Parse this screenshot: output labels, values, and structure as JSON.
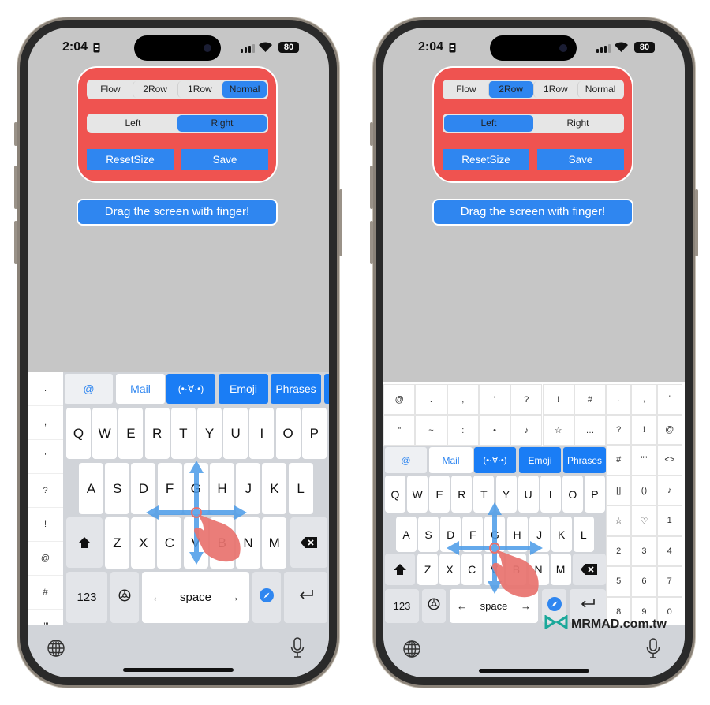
{
  "phones": [
    {
      "status": {
        "time": "2:04",
        "battery": "80"
      },
      "panel": {
        "modes": [
          "Flow",
          "2Row",
          "1Row",
          "Normal"
        ],
        "active_mode": "Normal",
        "sides": [
          "Left",
          "Right"
        ],
        "active_side": "Right",
        "reset_label": "ResetSize",
        "save_label": "Save"
      },
      "drag_label": "Drag the screen with finger!",
      "keyboard": {
        "layout": "Normal",
        "side_column": [
          ".",
          ",",
          "'",
          "?",
          "!",
          "@",
          "#",
          "\"\""
        ],
        "toolbar": [
          "@",
          "Mail",
          "(•·∀·•)",
          "Emoji",
          "Phrases"
        ],
        "rows": [
          [
            "Q",
            "W",
            "E",
            "R",
            "T",
            "Y",
            "U",
            "I",
            "O",
            "P"
          ],
          [
            "A",
            "S",
            "D",
            "F",
            "G",
            "H",
            "J",
            "K",
            "L"
          ],
          [
            "Z",
            "X",
            "C",
            "V",
            "B",
            "N",
            "M"
          ]
        ],
        "numbers_label": "123",
        "space_label": "space",
        "left_arrow": "←",
        "right_arrow": "→"
      }
    },
    {
      "status": {
        "time": "2:04",
        "battery": "80"
      },
      "panel": {
        "modes": [
          "Flow",
          "2Row",
          "1Row",
          "Normal"
        ],
        "active_mode": "2Row",
        "sides": [
          "Left",
          "Right"
        ],
        "active_side": "Left",
        "reset_label": "ResetSize",
        "save_label": "Save"
      },
      "drag_label": "Drag the screen with finger!",
      "keyboard": {
        "layout": "2Row",
        "symbol_rows": [
          [
            "@",
            ".",
            ",",
            "'",
            "?",
            "!",
            "#"
          ],
          [
            "\"",
            "~",
            ":",
            "•",
            "♪",
            "☆",
            "…"
          ]
        ],
        "right_grid": [
          [
            ".",
            ",",
            "'"
          ],
          [
            "?",
            "!",
            "@"
          ],
          [
            "#",
            "\"\"",
            "<>"
          ],
          [
            "[]",
            "()",
            "♪"
          ],
          [
            "☆",
            "♡",
            "1"
          ],
          [
            "2",
            "3",
            "4"
          ],
          [
            "5",
            "6",
            "7"
          ],
          [
            "8",
            "9",
            "0"
          ]
        ],
        "toolbar": [
          "@",
          "Mail",
          "(•·∀·•)",
          "Emoji",
          "Phrases"
        ],
        "rows": [
          [
            "Q",
            "W",
            "E",
            "R",
            "T",
            "Y",
            "U",
            "I",
            "O",
            "P"
          ],
          [
            "A",
            "S",
            "D",
            "F",
            "G",
            "H",
            "J",
            "K",
            "L"
          ],
          [
            "Z",
            "X",
            "C",
            "V",
            "B",
            "N",
            "M"
          ]
        ],
        "numbers_label": "123",
        "space_label": "space",
        "left_arrow": "←",
        "right_arrow": "→"
      }
    }
  ],
  "watermark": "MRMAD.com.tw",
  "colors": {
    "accent": "#2f86f0",
    "panel": "#ef5350",
    "gesture": "#4a9be8",
    "hand": "#e8726e"
  }
}
